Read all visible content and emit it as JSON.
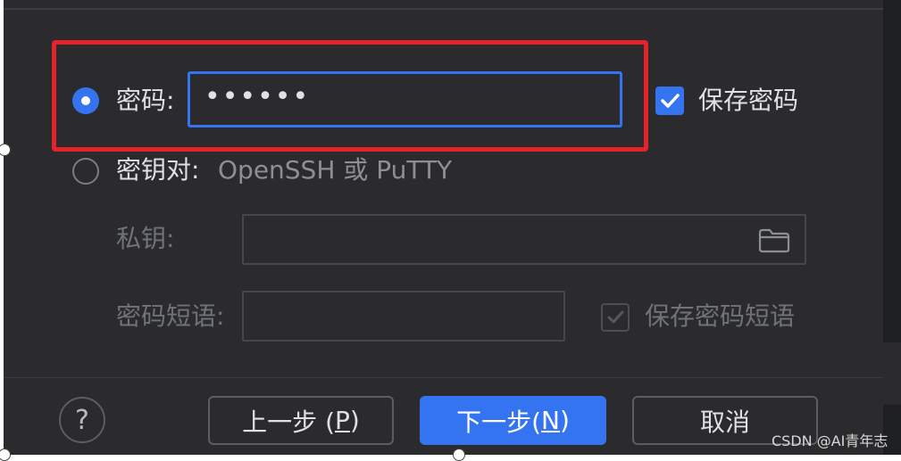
{
  "auth": {
    "password": {
      "label": "密码:",
      "value": "••••••",
      "selected": true
    },
    "save_password": {
      "label": "保存密码",
      "checked": true
    },
    "key_pair": {
      "label": "密钥对:",
      "hint": "OpenSSH 或 PuTTY",
      "selected": false
    },
    "private_key": {
      "label": "私钥:",
      "value": ""
    },
    "passphrase": {
      "label": "密码短语:",
      "value": ""
    },
    "save_passphrase": {
      "label": "保存密码短语",
      "checked": true,
      "enabled": false
    }
  },
  "footer": {
    "help_glyph": "?",
    "prev_button": {
      "text": "上一步 (",
      "mnemonic": "P",
      "close": ")"
    },
    "next_button": {
      "text": "下一步(",
      "mnemonic": "N",
      "close": ")"
    },
    "cancel_button": "取消"
  },
  "watermark": "CSDN @AI青年志",
  "icons": {
    "folder": "folder-icon",
    "check": "checkmark-icon",
    "help": "question-mark-icon"
  },
  "colors": {
    "accent": "#3574f0",
    "highlight": "#e5232a",
    "background": "#2b2b2d"
  }
}
